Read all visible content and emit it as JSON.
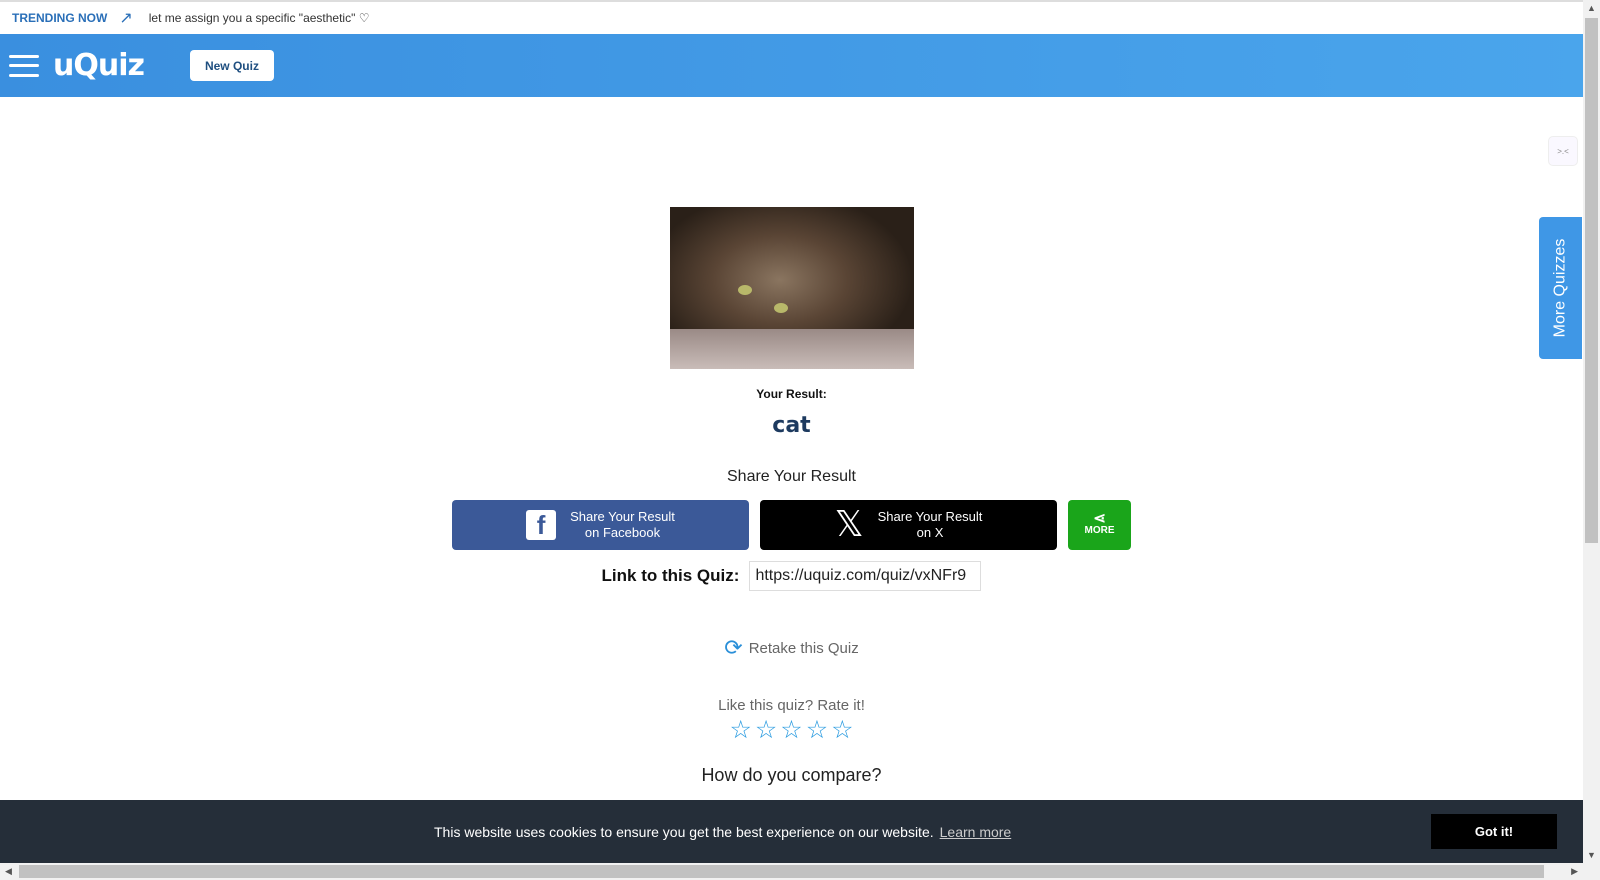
{
  "trending": {
    "label": "TRENDING NOW",
    "link": "let me assign you a specific \"aesthetic\" ♡"
  },
  "header": {
    "logo": "uQuiz",
    "new_quiz": "New Quiz"
  },
  "result": {
    "label": "Your Result:",
    "value": "cat"
  },
  "share": {
    "title": "Share Your Result",
    "facebook_line1": "Share Your Result",
    "facebook_line2": "on Facebook",
    "x_line1": "Share Your Result",
    "x_line2": "on X",
    "more": "MORE"
  },
  "link": {
    "label": "Link to this Quiz:",
    "value": "https://uquiz.com/quiz/vxNFr9"
  },
  "retake": "Retake this Quiz",
  "rating": {
    "prompt": "Like this quiz? Rate it!",
    "stars": 5,
    "rating": 0
  },
  "compare": "How do you compare?",
  "side": {
    "more_quizzes": "More Quizzes",
    "badge": ">.<"
  },
  "cookie": {
    "message": "This website uses cookies to ensure you get the best experience on our website.",
    "learn_more": "Learn more",
    "got_it": "Got it!"
  },
  "colors": {
    "header": "#3f97e6",
    "facebook": "#3b5998",
    "x": "#000000",
    "more": "#1aa51a",
    "cookie_bar": "#252e39"
  }
}
